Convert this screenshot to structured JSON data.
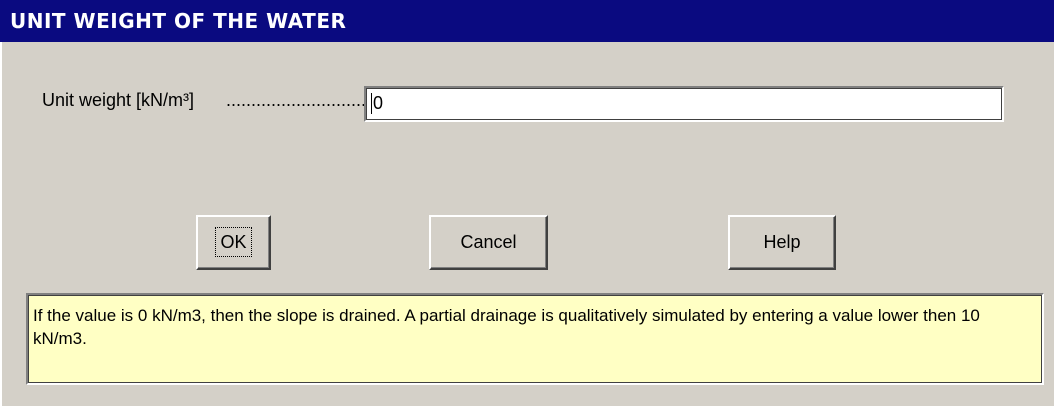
{
  "window": {
    "title": "UNIT WEIGHT OF THE WATER"
  },
  "field": {
    "label": "Unit weight [kN/m³]",
    "dots": "..................................................",
    "value": "0"
  },
  "buttons": {
    "ok": "OK",
    "cancel": "Cancel",
    "help": "Help"
  },
  "info": {
    "text": "If the value is 0 kN/m3, then the slope is drained. A partial drainage is qualitatively simulated by entering a value lower then 10 kN/m3."
  },
  "colors": {
    "titlebar": "#0a0a80",
    "dialog": "#d4d0c8",
    "info_background": "#ffffc4"
  }
}
